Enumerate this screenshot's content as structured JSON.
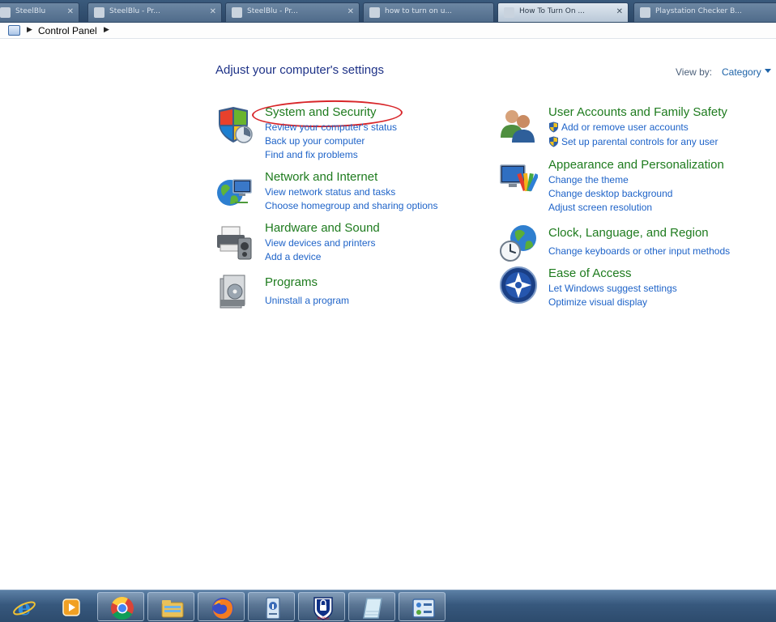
{
  "browser_tabs": [
    {
      "label": "SteelBlu"
    },
    {
      "label": "SteelBlu - Pr..."
    },
    {
      "label": "SteelBlu - Pr..."
    },
    {
      "label": "how to turn on u..."
    },
    {
      "label": "How To Turn On ..."
    },
    {
      "label": "Playstation Checker B..."
    }
  ],
  "breadcrumb": {
    "root_label": "Control Panel"
  },
  "page": {
    "title": "Adjust your computer's settings",
    "view_by_label": "View by:",
    "view_by_value": "Category"
  },
  "categories": [
    {
      "title": "System and Security",
      "links": [
        "Review your computer's status",
        "Back up your computer",
        "Find and fix problems"
      ]
    },
    {
      "title": "Network and Internet",
      "links": [
        "View network status and tasks",
        "Choose homegroup and sharing options"
      ]
    },
    {
      "title": "Hardware and Sound",
      "links": [
        "View devices and printers",
        "Add a device"
      ]
    },
    {
      "title": "Programs",
      "links": [
        "Uninstall a program"
      ]
    },
    {
      "title": "User Accounts and Family Safety",
      "links": [
        "Add or remove user accounts",
        "Set up parental controls for any user"
      ]
    },
    {
      "title": "Appearance and Personalization",
      "links": [
        "Change the theme",
        "Change desktop background",
        "Adjust screen resolution"
      ]
    },
    {
      "title": "Clock, Language, and Region",
      "links": [
        "Change keyboards or other input methods"
      ]
    },
    {
      "title": "Ease of Access",
      "links": [
        "Let Windows suggest settings",
        "Optimize visual display"
      ]
    }
  ],
  "taskbar": {
    "items": [
      "internet-explorer-icon",
      "media-player-icon",
      "chrome-icon",
      "file-explorer-icon",
      "firefox-icon",
      "system-info-icon",
      "mcafee-icon",
      "notepad-icon",
      "control-panel-icon"
    ],
    "mcafee_label": "McAfee"
  },
  "colors": {
    "title_blue": "#1e3287",
    "category_green": "#1e7b1e",
    "link_blue": "#1e63c8",
    "annotation_red": "#d8262a"
  }
}
